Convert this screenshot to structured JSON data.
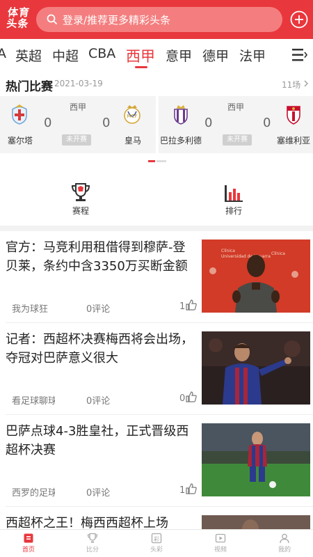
{
  "header": {
    "logo_line1": "体育",
    "logo_line2": "头条",
    "search_placeholder": "登录/推荐更多精彩头条"
  },
  "tabs": [
    "A",
    "英超",
    "中超",
    "CBA",
    "西甲",
    "意甲",
    "德甲",
    "法甲"
  ],
  "active_tab": "西甲",
  "hot": {
    "title": "热门比赛",
    "date": "2021-03-19",
    "count": "11场"
  },
  "matches": [
    {
      "league": "西甲",
      "home": "塞尔塔",
      "away": "皇马",
      "home_score": "0",
      "away_score": "0",
      "status": "未开赛"
    },
    {
      "league": "西甲",
      "home": "巴拉多利德",
      "away": "塞维利亚",
      "home_score": "0",
      "away_score": "0",
      "status": "未开赛"
    }
  ],
  "shortcuts": [
    {
      "label": "赛程",
      "icon": "trophy-icon"
    },
    {
      "label": "排行",
      "icon": "bar-chart-icon"
    }
  ],
  "news": [
    {
      "headline": "官方：马竞利用租借得到穆萨-登贝莱，条约中含3350万买断金额",
      "source": "我为球狂",
      "comments": "0评论",
      "likes": "1"
    },
    {
      "headline": "记者：西超杯决赛梅西将会出场，夺冠对巴萨意义很大",
      "source": "看足球聊球",
      "comments": "0评论",
      "likes": "0"
    },
    {
      "headline": "巴萨点球4-3胜皇社，正式晋级西超杯决赛",
      "source": "西罗的足球",
      "comments": "0评论",
      "likes": "1"
    },
    {
      "headline": "西超杯之王！梅西西超杯上场",
      "source": "",
      "comments": "",
      "likes": ""
    }
  ],
  "bottom_nav": [
    {
      "label": "首页",
      "icon": "home-icon",
      "active": true
    },
    {
      "label": "比分",
      "icon": "trophy-icon",
      "active": false
    },
    {
      "label": "头彩",
      "icon": "lottery-icon",
      "active": false
    },
    {
      "label": "视频",
      "icon": "video-icon",
      "active": false
    },
    {
      "label": "我的",
      "icon": "user-icon",
      "active": false
    }
  ],
  "colors": {
    "brand": "#e8383d",
    "search_bg": "#f47e7f",
    "muted": "#999999",
    "match_bg": "#f4f4f4"
  }
}
